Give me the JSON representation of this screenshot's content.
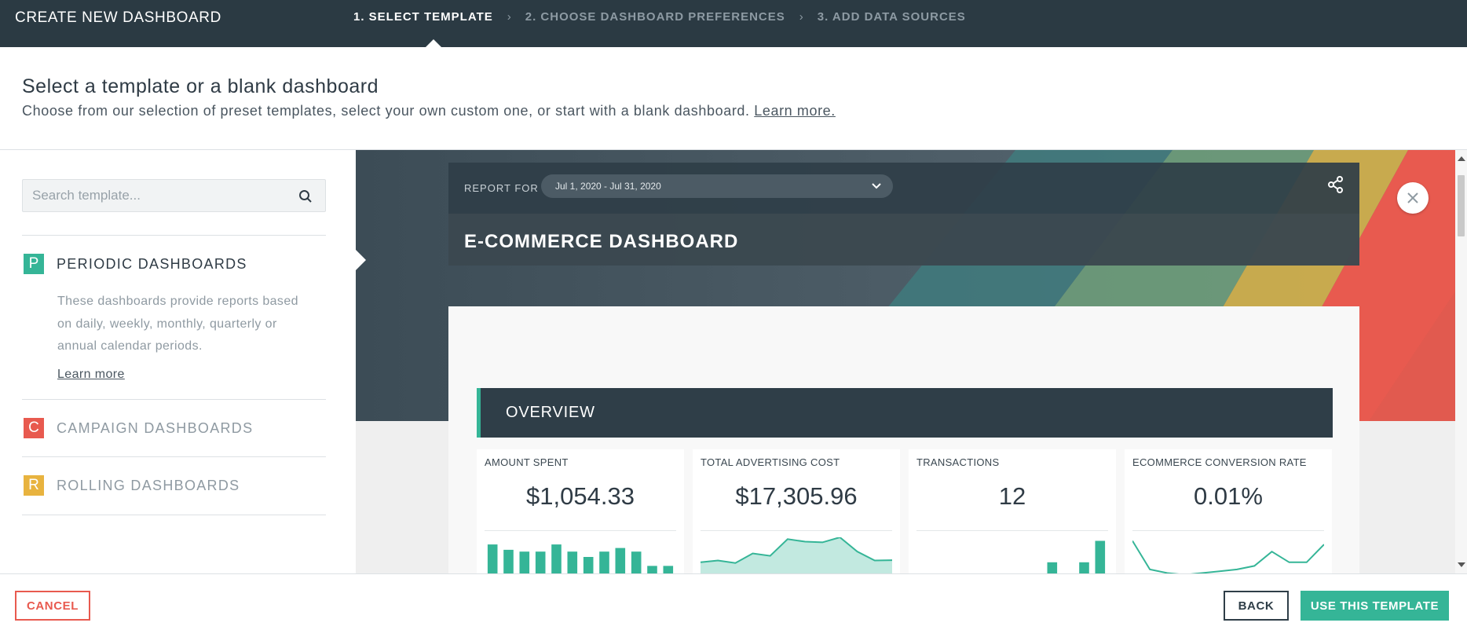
{
  "header": {
    "title": "CREATE NEW DASHBOARD",
    "steps": [
      {
        "label": "1. SELECT TEMPLATE",
        "active": true
      },
      {
        "label": "2. CHOOSE DASHBOARD PREFERENCES",
        "active": false
      },
      {
        "label": "3. ADD DATA SOURCES",
        "active": false
      }
    ],
    "step_separator": "›"
  },
  "intro": {
    "heading": "Select a template or a blank dashboard",
    "description": "Choose from our selection of preset templates, select your own custom one, or start with a blank dashboard.",
    "learn_more": "Learn more."
  },
  "sidebar": {
    "search_placeholder": "Search template...",
    "search_icon": "search-icon",
    "categories": [
      {
        "badge": "P",
        "label": "PERIODIC DASHBOARDS",
        "color": "#35b597",
        "active": true,
        "description": "These dashboards provide reports based on daily, weekly, monthly, quarterly or annual calendar periods.",
        "learn_more": "Learn more"
      },
      {
        "badge": "C",
        "label": "CAMPAIGN DASHBOARDS",
        "color": "#e85a4f",
        "active": false
      },
      {
        "badge": "R",
        "label": "ROLLING DASHBOARDS",
        "color": "#e8b33f",
        "active": false
      }
    ]
  },
  "preview": {
    "report_for": "REPORT FOR",
    "date_range": "Jul 1, 2020 - Jul 31, 2020",
    "dashboard_title": "E-COMMERCE DASHBOARD",
    "section_title": "OVERVIEW",
    "accent": "#35b597",
    "kpis": [
      {
        "label": "AMOUNT SPENT",
        "value": "$1,054.33",
        "spark_type": "bar",
        "spark": [
          9,
          7.5,
          7,
          7,
          9,
          7,
          5.5,
          7,
          8,
          7,
          3,
          3
        ]
      },
      {
        "label": "TOTAL ADVERTISING COST",
        "value": "$17,305.96",
        "spark_type": "area",
        "spark": [
          4,
          4.5,
          3.8,
          6.5,
          5.8,
          10.5,
          9.8,
          9.6,
          11,
          7,
          4.5,
          4.6
        ]
      },
      {
        "label": "TRANSACTIONS",
        "value": "12",
        "spark_type": "bar",
        "spark": [
          0.5,
          0,
          0,
          0,
          0,
          0,
          0,
          0,
          4,
          0,
          4,
          10
        ]
      },
      {
        "label": "ECOMMERCE CONVERSION RATE",
        "value": "0.01%",
        "spark_type": "line",
        "spark": [
          10,
          2,
          1,
          0.5,
          1,
          1.5,
          2,
          3,
          7,
          4,
          4,
          9
        ]
      }
    ]
  },
  "footer": {
    "cancel": "CANCEL",
    "back": "BACK",
    "use_template": "USE THIS TEMPLATE"
  },
  "colors": {
    "header_bg": "#2b3a43",
    "primary": "#35b597",
    "danger": "#e85a4f",
    "warning": "#e8b33f"
  }
}
